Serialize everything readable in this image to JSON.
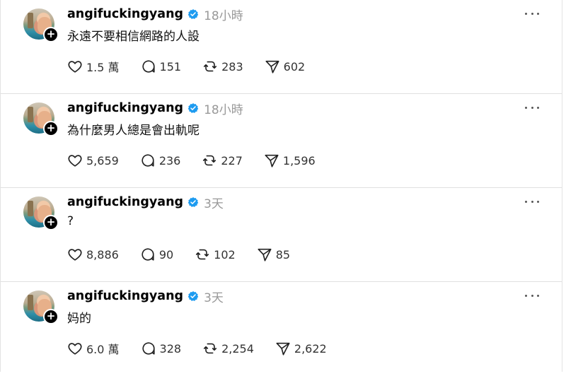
{
  "colors": {
    "verified": "#1d9bf0",
    "muted": "#999999"
  },
  "icons": {
    "like": "heart-icon",
    "reply": "comment-icon",
    "repost": "repost-icon",
    "share": "send-icon",
    "more": "more-options-icon",
    "follow": "plus-icon",
    "verified": "verified-badge-icon"
  },
  "posts": [
    {
      "username": "angifuckingyang",
      "time": "18小時",
      "text": "永遠不要相信網路的人設",
      "likes": "1.5 萬",
      "replies": "151",
      "reposts": "283",
      "shares": "602"
    },
    {
      "username": "angifuckingyang",
      "time": "18小時",
      "text": "為什麼男人總是會出軌呢",
      "likes": "5,659",
      "replies": "236",
      "reposts": "227",
      "shares": "1,596"
    },
    {
      "username": "angifuckingyang",
      "time": "3天",
      "text": "?",
      "likes": "8,886",
      "replies": "90",
      "reposts": "102",
      "shares": "85"
    },
    {
      "username": "angifuckingyang",
      "time": "3天",
      "text": "妈的",
      "likes": "6.0 萬",
      "replies": "328",
      "reposts": "2,254",
      "shares": "2,622"
    }
  ]
}
